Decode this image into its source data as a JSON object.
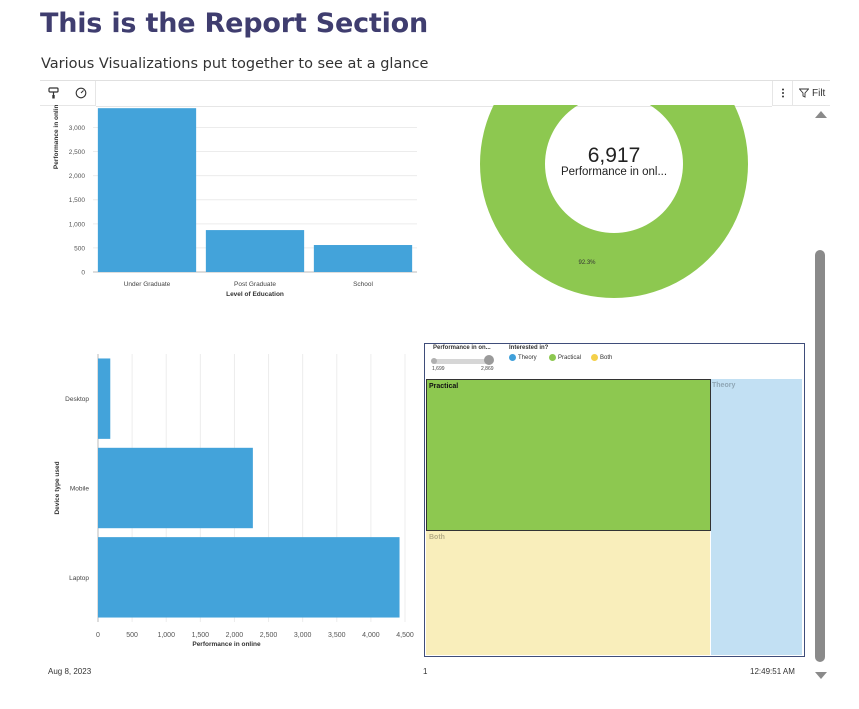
{
  "header": {
    "title": "This is the Report Section",
    "subtitle": "Various Visualizations put together to see at a glance"
  },
  "toolbar": {
    "left_icons": [
      "paint-format-icon",
      "speedometer-icon"
    ],
    "right": {
      "more_icon": "kebab-icon",
      "filter_icon": "filter-icon",
      "filter_label": "Filt"
    }
  },
  "footer": {
    "date": "Aug 8, 2023",
    "page_number": "1",
    "time": "12:49:51 AM"
  },
  "colors": {
    "bar": "#43a3da",
    "donut": "#8dc850",
    "theory": "#40a0da",
    "practical": "#8dc850",
    "both": "#f4d04a",
    "title": "#3f3d6f"
  },
  "chart_data": [
    {
      "type": "bar",
      "orientation": "vertical",
      "categories": [
        "Under Graduate",
        "Post Graduate",
        "School"
      ],
      "values": [
        3400,
        870,
        560
      ],
      "xlabel": "Level of Education",
      "ylabel": "Performance in online",
      "yticks": [
        "0",
        "500",
        "1,000",
        "1,500",
        "2,000",
        "2,500",
        "3,000"
      ],
      "ylim": [
        0,
        3300
      ],
      "grid": true
    },
    {
      "type": "pie",
      "variant": "donut",
      "center_value": "6,917",
      "center_label": "Performance in onl...",
      "slices": [
        {
          "label": "92.3%",
          "value": 92.3
        },
        {
          "label": "",
          "value": 7.7
        }
      ]
    },
    {
      "type": "bar",
      "orientation": "horizontal",
      "categories": [
        "Desktop",
        "Mobile",
        "Laptop"
      ],
      "values": [
        180,
        2270,
        4420
      ],
      "xlabel": "Performance in online",
      "ylabel": "Device type used",
      "xticks": [
        "0",
        "500",
        "1,000",
        "1,500",
        "2,000",
        "2,500",
        "3,000",
        "3,500",
        "4,000",
        "4,500"
      ],
      "xlim": [
        0,
        4500
      ],
      "grid": true
    },
    {
      "type": "treemap",
      "size_legend": {
        "title": "Performance in on...",
        "min": "1,699",
        "max": "2,869"
      },
      "color_legend": {
        "title": "Interested in?",
        "items": [
          "Theory",
          "Practical",
          "Both"
        ]
      },
      "nodes": [
        {
          "label": "Practical",
          "value": 2869,
          "highlighted": true
        },
        {
          "label": "Both",
          "value": 2349,
          "highlighted": false
        },
        {
          "label": "Theory",
          "value": 1699,
          "highlighted": false
        }
      ]
    }
  ]
}
